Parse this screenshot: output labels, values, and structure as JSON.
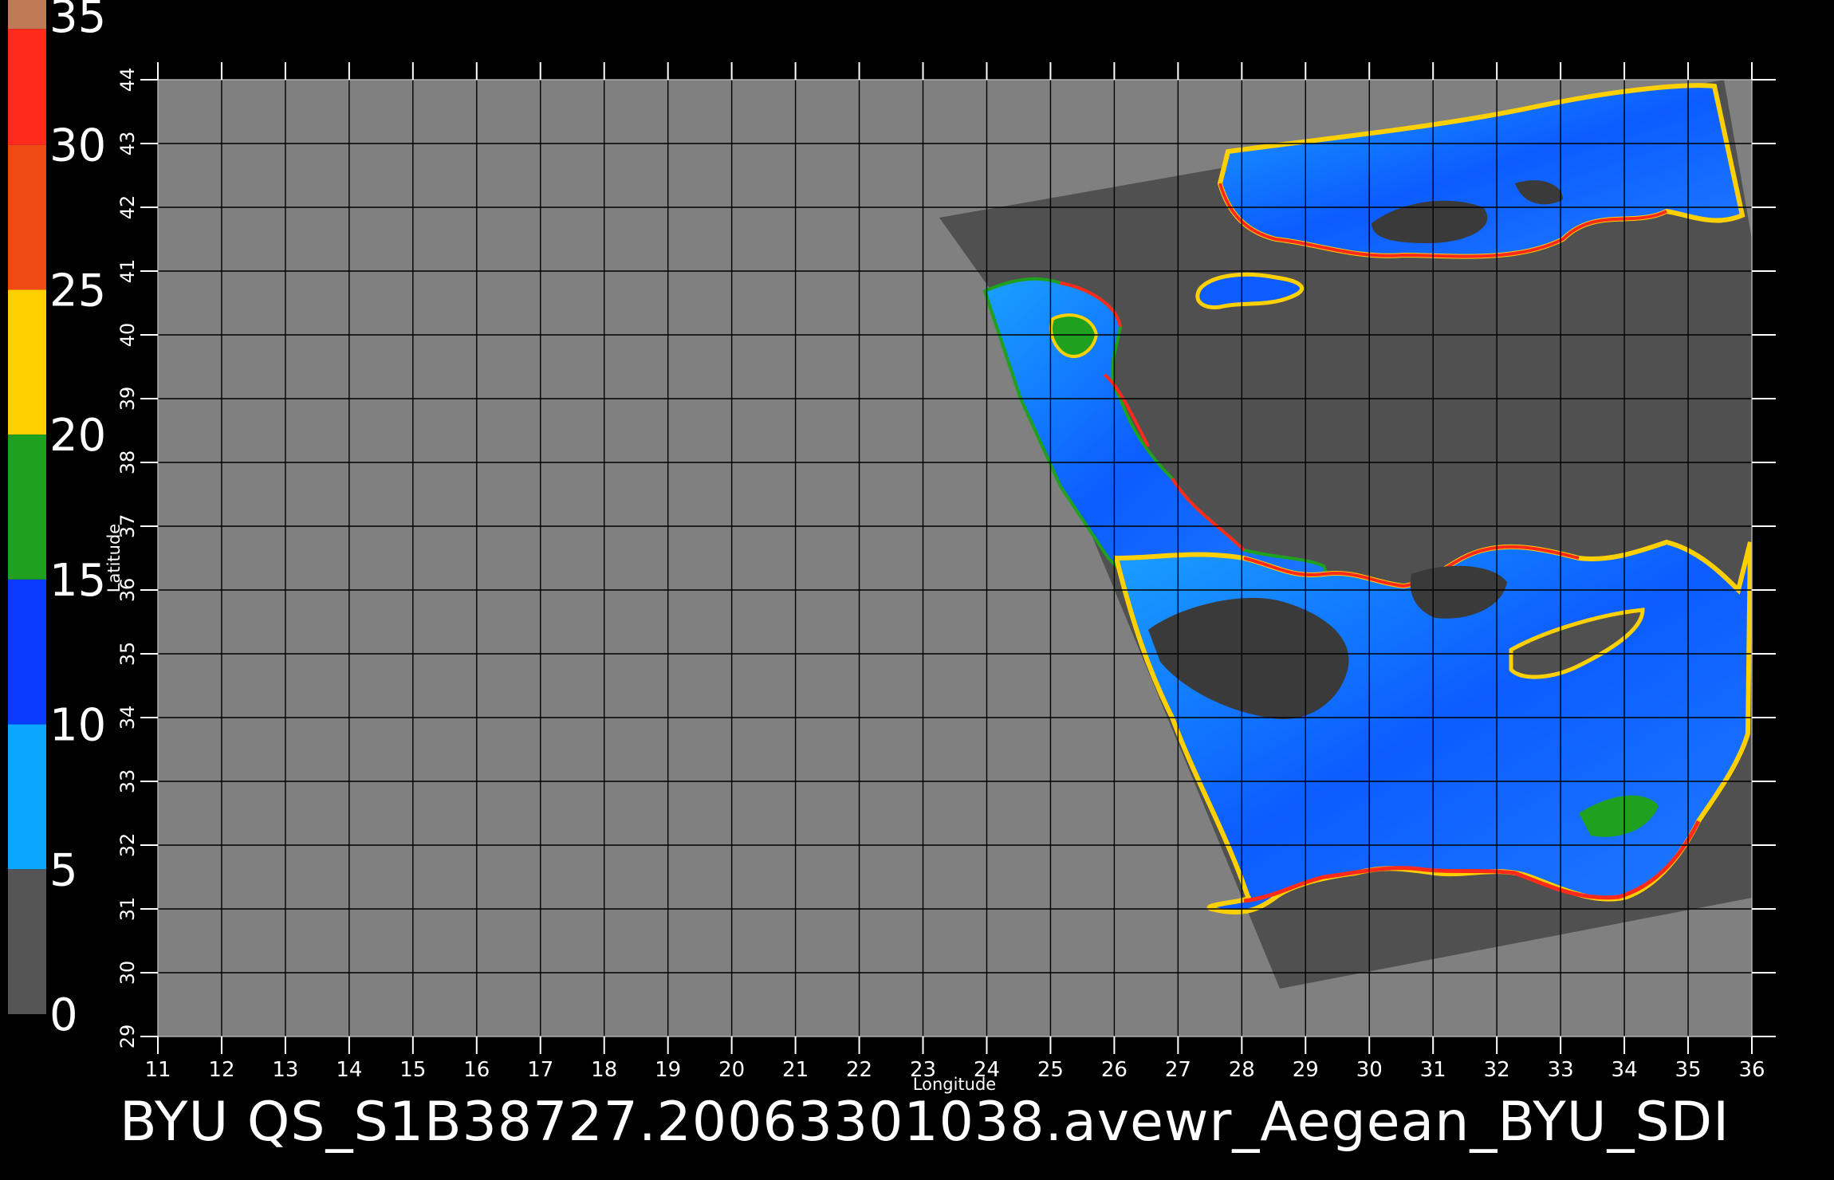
{
  "caption": "BYU  QS_S1B38727.20063301038.avewr_Aegean_BYU_SDI",
  "colorbar": {
    "ticks": [
      "35",
      "30",
      "25",
      "20",
      "15",
      "10",
      "5",
      "0"
    ],
    "segments": [
      {
        "from": 35,
        "to": 34,
        "color": "#c07a55"
      },
      {
        "from": 34,
        "to": 30,
        "color": "#ff2a1a"
      },
      {
        "from": 30,
        "to": 25,
        "color": "#f04a14"
      },
      {
        "from": 25,
        "to": 20,
        "color": "#ffd000"
      },
      {
        "from": 20,
        "to": 15,
        "color": "#1fa11f"
      },
      {
        "from": 15,
        "to": 10,
        "color": "#0a3cff"
      },
      {
        "from": 10,
        "to": 5,
        "color": "#0aa6ff"
      },
      {
        "from": 5,
        "to": 0,
        "color": "#555555"
      }
    ]
  },
  "map": {
    "xlabel": "Longitude",
    "ylabel": "Latitude",
    "lon_ticks": [
      "11",
      "12",
      "13",
      "14",
      "15",
      "16",
      "17",
      "18",
      "19",
      "20",
      "21",
      "22",
      "23",
      "24",
      "25",
      "26",
      "27",
      "28",
      "29",
      "30",
      "31",
      "32",
      "33",
      "34",
      "35",
      "36"
    ],
    "lat_ticks": [
      "29",
      "30",
      "31",
      "32",
      "33",
      "34",
      "35",
      "36",
      "37",
      "38",
      "39",
      "40",
      "41",
      "42",
      "43",
      "44"
    ],
    "lon_range": [
      11,
      36
    ],
    "lat_range": [
      29,
      44
    ],
    "background_color": "#808080",
    "swath_color": "#505050",
    "grid_color": "#000000"
  }
}
